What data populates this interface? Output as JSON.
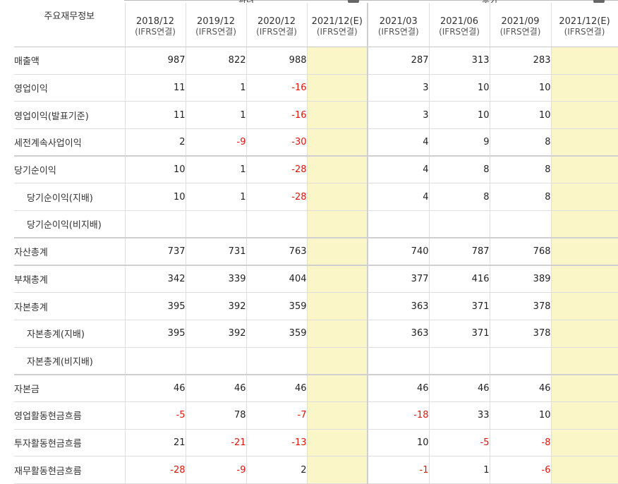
{
  "header": {
    "label_col": "주요재무정보",
    "annual_group_cut": "관련",
    "quarter_group_cut": "분기",
    "periods": [
      {
        "period": "2018/12",
        "sub": "(IFRS연결)"
      },
      {
        "period": "2019/12",
        "sub": "(IFRS연결)"
      },
      {
        "period": "2020/12",
        "sub": "(IFRS연결)"
      },
      {
        "period": "2021/12(E)",
        "sub": "(IFRS연결)"
      },
      {
        "period": "2021/03",
        "sub": "(IFRS연결)"
      },
      {
        "period": "2021/06",
        "sub": "(IFRS연결)"
      },
      {
        "period": "2021/09",
        "sub": "(IFRS연결)"
      },
      {
        "period": "2021/12(E)",
        "sub": "(IFRS연결)"
      }
    ]
  },
  "rows": [
    {
      "label": "매출액",
      "values": [
        "987",
        "822",
        "988",
        "",
        "287",
        "313",
        "283",
        ""
      ]
    },
    {
      "label": "영업이익",
      "values": [
        "11",
        "1",
        "-16",
        "",
        "3",
        "10",
        "10",
        ""
      ]
    },
    {
      "label": "영업이익(발표기준)",
      "values": [
        "11",
        "1",
        "-16",
        "",
        "3",
        "10",
        "10",
        ""
      ]
    },
    {
      "label": "세전계속사업이익",
      "values": [
        "2",
        "-9",
        "-30",
        "",
        "4",
        "9",
        "8",
        ""
      ]
    },
    {
      "label": "당기순이익",
      "values": [
        "10",
        "1",
        "-28",
        "",
        "4",
        "8",
        "8",
        ""
      ]
    },
    {
      "label": "당기순이익(지배)",
      "values": [
        "10",
        "1",
        "-28",
        "",
        "4",
        "8",
        "8",
        ""
      ]
    },
    {
      "label": "당기순이익(비지배)",
      "values": [
        "",
        "",
        "",
        "",
        "",
        "",
        "",
        ""
      ]
    },
    {
      "label": "자산총계",
      "values": [
        "737",
        "731",
        "763",
        "",
        "740",
        "787",
        "768",
        ""
      ]
    },
    {
      "label": "부채총계",
      "values": [
        "342",
        "339",
        "404",
        "",
        "377",
        "416",
        "389",
        ""
      ]
    },
    {
      "label": "자본총계",
      "values": [
        "395",
        "392",
        "359",
        "",
        "363",
        "371",
        "378",
        ""
      ]
    },
    {
      "label": "자본총계(지배)",
      "values": [
        "395",
        "392",
        "359",
        "",
        "363",
        "371",
        "378",
        ""
      ]
    },
    {
      "label": "자본총계(비지배)",
      "values": [
        "",
        "",
        "",
        "",
        "",
        "",
        "",
        ""
      ]
    },
    {
      "label": "자본금",
      "values": [
        "46",
        "46",
        "46",
        "",
        "46",
        "46",
        "46",
        ""
      ]
    },
    {
      "label": "영업활동현금흐름",
      "values": [
        "-5",
        "78",
        "-7",
        "",
        "-18",
        "33",
        "10",
        ""
      ]
    },
    {
      "label": "투자활동현금흐름",
      "values": [
        "21",
        "-21",
        "-13",
        "",
        "10",
        "-5",
        "-8",
        ""
      ]
    },
    {
      "label": "재무활동현금흐름",
      "values": [
        "-28",
        "-9",
        "2",
        "",
        "-1",
        "1",
        "-6",
        ""
      ]
    }
  ],
  "colors": {
    "negative": "#e0140b",
    "estimate_bg": "#fbf6c7",
    "grid": "#dedede"
  },
  "icons": {
    "collapse_annual": "toggle-circle-icon",
    "collapse_quarter": "toggle-circle-icon"
  }
}
